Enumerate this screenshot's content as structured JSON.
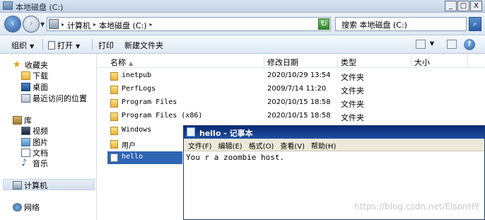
{
  "window": {
    "title": "本地磁盘 (C:)",
    "buttons": [
      "_",
      "□",
      "X"
    ]
  },
  "nav": {
    "back": "‹",
    "forward": "›"
  },
  "address": {
    "crumbs": [
      "计算机",
      "本地磁盘 (C:)"
    ],
    "search_placeholder": "搜索 本地磁盘 (C:)"
  },
  "toolbar": {
    "organize": "组织",
    "open": "打开",
    "print": "打印",
    "new_folder": "新建文件夹"
  },
  "sidebar": {
    "favorites": "收藏夹",
    "downloads": "下载",
    "desktop": "桌面",
    "recent": "最近访问的位置",
    "libraries": "库",
    "videos": "视频",
    "pictures": "图片",
    "documents": "文档",
    "music": "音乐",
    "computer": "计算机",
    "network": "网络"
  },
  "columns": {
    "name": "名称",
    "modified": "修改日期",
    "type": "类型",
    "size": "大小"
  },
  "files": [
    {
      "name": "inetpub",
      "date": "2020/10/29 13:54",
      "type": "文件夹",
      "icon": "folder"
    },
    {
      "name": "PerfLogs",
      "date": "2009/7/14 11:20",
      "type": "文件夹",
      "icon": "folder"
    },
    {
      "name": "Program Files",
      "date": "2020/10/15 18:58",
      "type": "文件夹",
      "icon": "folder"
    },
    {
      "name": "Program Files (x86)",
      "date": "2020/10/15 18:58",
      "type": "文件夹",
      "icon": "folder"
    },
    {
      "name": "Windows",
      "date": "",
      "type": "",
      "icon": "folder"
    },
    {
      "name": "用户",
      "date": "",
      "type": "",
      "icon": "folder"
    },
    {
      "name": "hello",
      "date": "",
      "type": "",
      "icon": "text-file",
      "selected": true
    }
  ],
  "notepad": {
    "title": "hello - 记事本",
    "menu": [
      "文件(F)",
      "编辑(E)",
      "格式(O)",
      "查看(V)",
      "帮助(H)"
    ],
    "content": "You r a zoombie host."
  },
  "watermark": "https://blog.csdn.net/ElsonHY"
}
